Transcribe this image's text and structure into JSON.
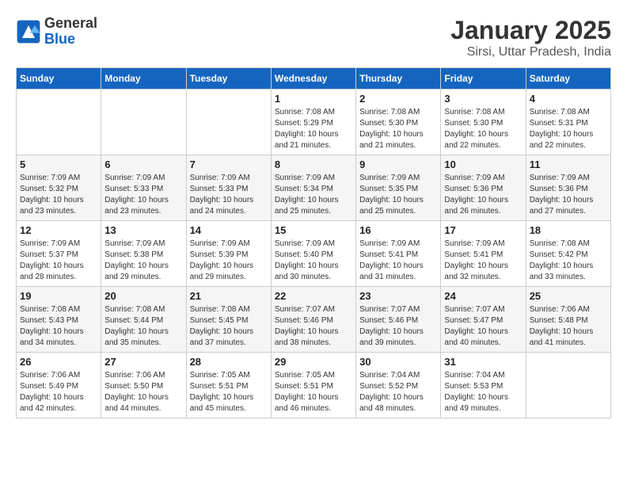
{
  "logo": {
    "text_general": "General",
    "text_blue": "Blue"
  },
  "title": "January 2025",
  "subtitle": "Sirsi, Uttar Pradesh, India",
  "days_of_week": [
    "Sunday",
    "Monday",
    "Tuesday",
    "Wednesday",
    "Thursday",
    "Friday",
    "Saturday"
  ],
  "weeks": [
    [
      {
        "day": "",
        "sunrise": "",
        "sunset": "",
        "daylight": ""
      },
      {
        "day": "",
        "sunrise": "",
        "sunset": "",
        "daylight": ""
      },
      {
        "day": "",
        "sunrise": "",
        "sunset": "",
        "daylight": ""
      },
      {
        "day": "1",
        "sunrise": "Sunrise: 7:08 AM",
        "sunset": "Sunset: 5:29 PM",
        "daylight": "Daylight: 10 hours and 21 minutes."
      },
      {
        "day": "2",
        "sunrise": "Sunrise: 7:08 AM",
        "sunset": "Sunset: 5:30 PM",
        "daylight": "Daylight: 10 hours and 21 minutes."
      },
      {
        "day": "3",
        "sunrise": "Sunrise: 7:08 AM",
        "sunset": "Sunset: 5:30 PM",
        "daylight": "Daylight: 10 hours and 22 minutes."
      },
      {
        "day": "4",
        "sunrise": "Sunrise: 7:08 AM",
        "sunset": "Sunset: 5:31 PM",
        "daylight": "Daylight: 10 hours and 22 minutes."
      }
    ],
    [
      {
        "day": "5",
        "sunrise": "Sunrise: 7:09 AM",
        "sunset": "Sunset: 5:32 PM",
        "daylight": "Daylight: 10 hours and 23 minutes."
      },
      {
        "day": "6",
        "sunrise": "Sunrise: 7:09 AM",
        "sunset": "Sunset: 5:33 PM",
        "daylight": "Daylight: 10 hours and 23 minutes."
      },
      {
        "day": "7",
        "sunrise": "Sunrise: 7:09 AM",
        "sunset": "Sunset: 5:33 PM",
        "daylight": "Daylight: 10 hours and 24 minutes."
      },
      {
        "day": "8",
        "sunrise": "Sunrise: 7:09 AM",
        "sunset": "Sunset: 5:34 PM",
        "daylight": "Daylight: 10 hours and 25 minutes."
      },
      {
        "day": "9",
        "sunrise": "Sunrise: 7:09 AM",
        "sunset": "Sunset: 5:35 PM",
        "daylight": "Daylight: 10 hours and 25 minutes."
      },
      {
        "day": "10",
        "sunrise": "Sunrise: 7:09 AM",
        "sunset": "Sunset: 5:36 PM",
        "daylight": "Daylight: 10 hours and 26 minutes."
      },
      {
        "day": "11",
        "sunrise": "Sunrise: 7:09 AM",
        "sunset": "Sunset: 5:36 PM",
        "daylight": "Daylight: 10 hours and 27 minutes."
      }
    ],
    [
      {
        "day": "12",
        "sunrise": "Sunrise: 7:09 AM",
        "sunset": "Sunset: 5:37 PM",
        "daylight": "Daylight: 10 hours and 28 minutes."
      },
      {
        "day": "13",
        "sunrise": "Sunrise: 7:09 AM",
        "sunset": "Sunset: 5:38 PM",
        "daylight": "Daylight: 10 hours and 29 minutes."
      },
      {
        "day": "14",
        "sunrise": "Sunrise: 7:09 AM",
        "sunset": "Sunset: 5:39 PM",
        "daylight": "Daylight: 10 hours and 29 minutes."
      },
      {
        "day": "15",
        "sunrise": "Sunrise: 7:09 AM",
        "sunset": "Sunset: 5:40 PM",
        "daylight": "Daylight: 10 hours and 30 minutes."
      },
      {
        "day": "16",
        "sunrise": "Sunrise: 7:09 AM",
        "sunset": "Sunset: 5:41 PM",
        "daylight": "Daylight: 10 hours and 31 minutes."
      },
      {
        "day": "17",
        "sunrise": "Sunrise: 7:09 AM",
        "sunset": "Sunset: 5:41 PM",
        "daylight": "Daylight: 10 hours and 32 minutes."
      },
      {
        "day": "18",
        "sunrise": "Sunrise: 7:08 AM",
        "sunset": "Sunset: 5:42 PM",
        "daylight": "Daylight: 10 hours and 33 minutes."
      }
    ],
    [
      {
        "day": "19",
        "sunrise": "Sunrise: 7:08 AM",
        "sunset": "Sunset: 5:43 PM",
        "daylight": "Daylight: 10 hours and 34 minutes."
      },
      {
        "day": "20",
        "sunrise": "Sunrise: 7:08 AM",
        "sunset": "Sunset: 5:44 PM",
        "daylight": "Daylight: 10 hours and 35 minutes."
      },
      {
        "day": "21",
        "sunrise": "Sunrise: 7:08 AM",
        "sunset": "Sunset: 5:45 PM",
        "daylight": "Daylight: 10 hours and 37 minutes."
      },
      {
        "day": "22",
        "sunrise": "Sunrise: 7:07 AM",
        "sunset": "Sunset: 5:46 PM",
        "daylight": "Daylight: 10 hours and 38 minutes."
      },
      {
        "day": "23",
        "sunrise": "Sunrise: 7:07 AM",
        "sunset": "Sunset: 5:46 PM",
        "daylight": "Daylight: 10 hours and 39 minutes."
      },
      {
        "day": "24",
        "sunrise": "Sunrise: 7:07 AM",
        "sunset": "Sunset: 5:47 PM",
        "daylight": "Daylight: 10 hours and 40 minutes."
      },
      {
        "day": "25",
        "sunrise": "Sunrise: 7:06 AM",
        "sunset": "Sunset: 5:48 PM",
        "daylight": "Daylight: 10 hours and 41 minutes."
      }
    ],
    [
      {
        "day": "26",
        "sunrise": "Sunrise: 7:06 AM",
        "sunset": "Sunset: 5:49 PM",
        "daylight": "Daylight: 10 hours and 42 minutes."
      },
      {
        "day": "27",
        "sunrise": "Sunrise: 7:06 AM",
        "sunset": "Sunset: 5:50 PM",
        "daylight": "Daylight: 10 hours and 44 minutes."
      },
      {
        "day": "28",
        "sunrise": "Sunrise: 7:05 AM",
        "sunset": "Sunset: 5:51 PM",
        "daylight": "Daylight: 10 hours and 45 minutes."
      },
      {
        "day": "29",
        "sunrise": "Sunrise: 7:05 AM",
        "sunset": "Sunset: 5:51 PM",
        "daylight": "Daylight: 10 hours and 46 minutes."
      },
      {
        "day": "30",
        "sunrise": "Sunrise: 7:04 AM",
        "sunset": "Sunset: 5:52 PM",
        "daylight": "Daylight: 10 hours and 48 minutes."
      },
      {
        "day": "31",
        "sunrise": "Sunrise: 7:04 AM",
        "sunset": "Sunset: 5:53 PM",
        "daylight": "Daylight: 10 hours and 49 minutes."
      },
      {
        "day": "",
        "sunrise": "",
        "sunset": "",
        "daylight": ""
      }
    ]
  ]
}
